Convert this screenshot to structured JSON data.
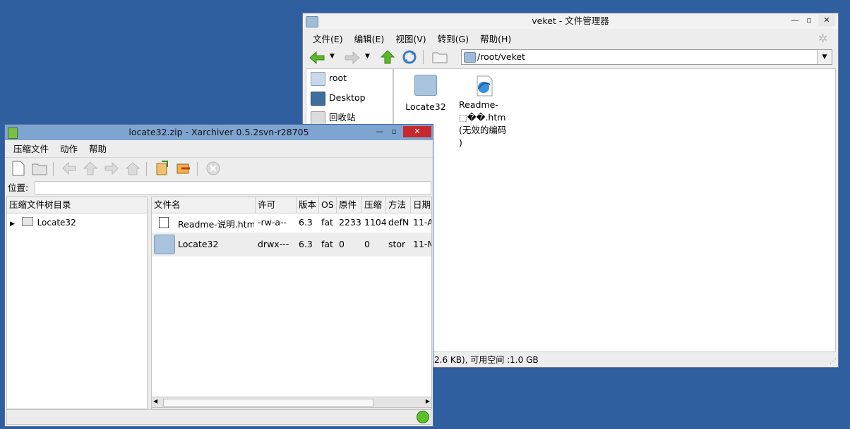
{
  "desktop": {
    "background": "#2f5f9e"
  },
  "file_manager": {
    "title": "veket - 文件管理器",
    "menu": [
      "文件(E)",
      "编辑(E)",
      "视图(V)",
      "转到(G)",
      "帮助(H)"
    ],
    "address": "/root/veket",
    "sidebar": [
      {
        "label": "root",
        "icon": "home-icon"
      },
      {
        "label": "Desktop",
        "icon": "desktop-icon"
      },
      {
        "label": "回收站",
        "icon": "trash-icon"
      }
    ],
    "items": [
      {
        "label": "Locate32",
        "icon": "folder-icon"
      },
      {
        "label": "Readme-\n⬚��.htm\n(无效的编码\n)",
        "icon": "html-file-icon"
      }
    ],
    "status": "2.6 KB), 可用空间 :1.0 GB"
  },
  "xarchiver": {
    "title": "locate32.zip - Xarchiver 0.5.2svn-r28705",
    "menu": [
      "压缩文件",
      "动作",
      "帮助"
    ],
    "location_label": "位置:",
    "location_value": "",
    "tree_header": "压缩文件树目录",
    "tree_items": [
      {
        "label": "Locate32"
      }
    ],
    "columns": [
      "文件名",
      "许可",
      "版本",
      "OS",
      "原件",
      "压缩",
      "方法",
      "日期"
    ],
    "rows": [
      {
        "name": "Readme-说明.htm",
        "perm": "-rw-a--",
        "ver": "6.3",
        "os": "fat",
        "orig": "2233",
        "comp": "1104",
        "method": "defN",
        "date": "11-A"
      },
      {
        "name": "Locate32",
        "perm": "drwx---",
        "ver": "6.3",
        "os": "fat",
        "orig": "0",
        "comp": "0",
        "method": "stor",
        "date": "11-M"
      }
    ],
    "status": ""
  }
}
